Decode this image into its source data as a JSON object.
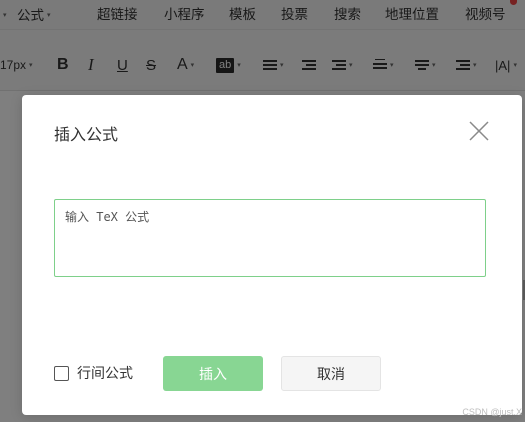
{
  "menubar": {
    "items": [
      {
        "label": "公式",
        "has_dropdown": true
      },
      {
        "label": "超链接"
      },
      {
        "label": "小程序"
      },
      {
        "label": "模板"
      },
      {
        "label": "投票"
      },
      {
        "label": "搜索"
      },
      {
        "label": "地理位置"
      },
      {
        "label": "视频号"
      }
    ]
  },
  "toolbar": {
    "font_size": "17px",
    "bold": "B",
    "italic": "I",
    "underline": "U",
    "strikethrough": "S",
    "font_color": "A",
    "background_color": "ab"
  },
  "dialog": {
    "title": "插入公式",
    "input_placeholder": "输入 TeX 公式",
    "input_value": "",
    "inline_label": "行间公式",
    "inline_checked": false,
    "insert_label": "插入",
    "cancel_label": "取消",
    "colors": {
      "input_border": "#7ed08a",
      "insert_button": "#88d693"
    }
  },
  "watermark": "CSDN @just.X"
}
